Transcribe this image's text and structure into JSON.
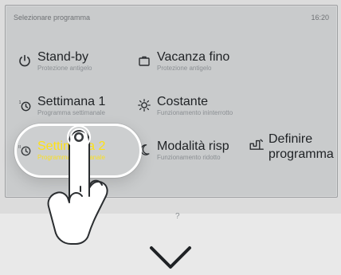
{
  "header": {
    "title": "Selezionare programma",
    "time": "16:20"
  },
  "programs": [
    {
      "icon": "power-icon",
      "label": "Stand-by",
      "sub": "Protezione antigelo"
    },
    {
      "icon": "suitcase-icon",
      "label": "Vacanza fino",
      "sub": "Protezione antigelo"
    },
    {
      "icon": "clock-1-icon",
      "label": "Settimana 1",
      "sub": "Programma settimanale"
    },
    {
      "icon": "sun-icon",
      "label": "Costante",
      "sub": "Funzionamento ininterrotto"
    },
    {
      "icon": "clock-2-icon",
      "label": "Settimana 2",
      "sub": "Programma settimanale",
      "active": true
    },
    {
      "icon": "moon-icon",
      "label": "Modalità risp",
      "sub": "Funzionamento ridotto"
    },
    {
      "icon": "define-program-icon",
      "label": "Definire programma",
      "sub": ""
    }
  ],
  "help": {
    "text": "?"
  },
  "accent": "#ffe000"
}
